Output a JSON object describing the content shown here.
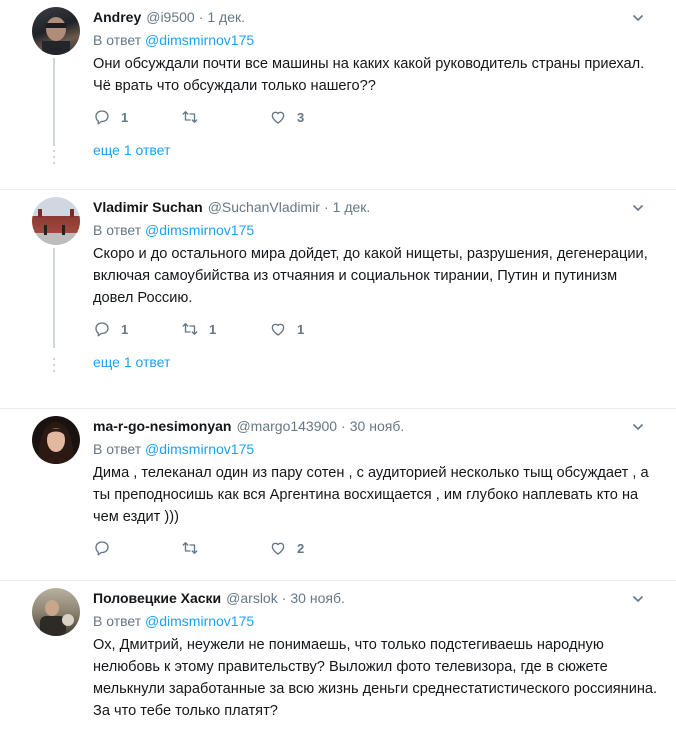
{
  "tweets": [
    {
      "name": "Andrey",
      "handle": "@i9500",
      "dot": "·",
      "time": "1 дек.",
      "reply_prefix": "В ответ",
      "mention": "@dimsmirnov175",
      "text": "Они обсуждали почти все машины на каких какой руководитель страны приехал. Чё врать что обсуждали только нашего??",
      "replies": "1",
      "retweets": "",
      "likes": "3",
      "more": "еще 1 ответ"
    },
    {
      "name": "Vladimir Suchan",
      "handle": "@SuchanVladimir",
      "dot": "·",
      "time": "1 дек.",
      "reply_prefix": "В ответ",
      "mention": "@dimsmirnov175",
      "text": "Скоро и до остального мира дойдет, до какой нищеты, разрушения, дегенерации, включая самоубийства из отчаяния и социальнок тирании, Путин и путинизм довел Россию.",
      "replies": "1",
      "retweets": "1",
      "likes": "1",
      "more": "еще 1 ответ"
    },
    {
      "name": "ma-r-go-nesimonyan",
      "handle": "@margo143900",
      "dot": "·",
      "time": "30 нояб.",
      "reply_prefix": "В ответ",
      "mention": "@dimsmirnov175",
      "text": "Дима , телеканал один из пару сотен , с аудиторией несколько тыщ обсуждает , а ты преподносишь как вся Аргентина восхищается , им глубоко наплевать кто на чем ездит )))",
      "replies": "",
      "retweets": "",
      "likes": "2"
    },
    {
      "name": "Половецкие Хаски",
      "handle": "@arslok",
      "dot": "·",
      "time": "30 нояб.",
      "reply_prefix": "В ответ",
      "mention": "@dimsmirnov175",
      "text": "Ох, Дмитрий, неужели не понимаешь, что только подстегиваешь народную нелюбовь к этому правительству? Выложил фото телевизора, где в сюжете мелькнули заработанные за всю жизнь деньги среднестатистического россиянина. За что тебе только платят?"
    }
  ],
  "colors": {
    "link": "#1da1f2",
    "muted": "#657786",
    "text": "#14171a",
    "border": "#e6ecf0"
  }
}
